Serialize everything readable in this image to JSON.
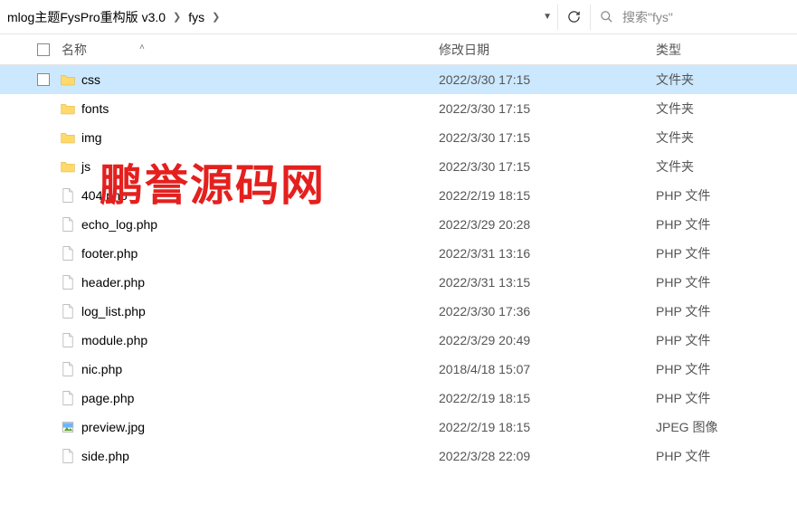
{
  "breadcrumb": {
    "a": "mlog主题FysPro重构版 v3.0",
    "b": "fys"
  },
  "search": {
    "placeholder": "搜索\"fys\""
  },
  "columns": {
    "name": "名称",
    "date": "修改日期",
    "type": "类型"
  },
  "files": [
    {
      "icon": "folder",
      "name": "css",
      "date": "2022/3/30 17:15",
      "type": "文件夹",
      "sel": true
    },
    {
      "icon": "folder",
      "name": "fonts",
      "date": "2022/3/30 17:15",
      "type": "文件夹",
      "sel": false
    },
    {
      "icon": "folder",
      "name": "img",
      "date": "2022/3/30 17:15",
      "type": "文件夹",
      "sel": false
    },
    {
      "icon": "folder",
      "name": "js",
      "date": "2022/3/30 17:15",
      "type": "文件夹",
      "sel": false
    },
    {
      "icon": "file",
      "name": "404.php",
      "date": "2022/2/19 18:15",
      "type": "PHP 文件",
      "sel": false
    },
    {
      "icon": "file",
      "name": "echo_log.php",
      "date": "2022/3/29 20:28",
      "type": "PHP 文件",
      "sel": false
    },
    {
      "icon": "file",
      "name": "footer.php",
      "date": "2022/3/31 13:16",
      "type": "PHP 文件",
      "sel": false
    },
    {
      "icon": "file",
      "name": "header.php",
      "date": "2022/3/31 13:15",
      "type": "PHP 文件",
      "sel": false
    },
    {
      "icon": "file",
      "name": "log_list.php",
      "date": "2022/3/30 17:36",
      "type": "PHP 文件",
      "sel": false
    },
    {
      "icon": "file",
      "name": "module.php",
      "date": "2022/3/29 20:49",
      "type": "PHP 文件",
      "sel": false
    },
    {
      "icon": "file",
      "name": "nic.php",
      "date": "2018/4/18 15:07",
      "type": "PHP 文件",
      "sel": false
    },
    {
      "icon": "file",
      "name": "page.php",
      "date": "2022/2/19 18:15",
      "type": "PHP 文件",
      "sel": false
    },
    {
      "icon": "image",
      "name": "preview.jpg",
      "date": "2022/2/19 18:15",
      "type": "JPEG 图像",
      "sel": false
    },
    {
      "icon": "file",
      "name": "side.php",
      "date": "2022/3/28 22:09",
      "type": "PHP 文件",
      "sel": false
    }
  ],
  "watermark": "鹏誉源码网"
}
